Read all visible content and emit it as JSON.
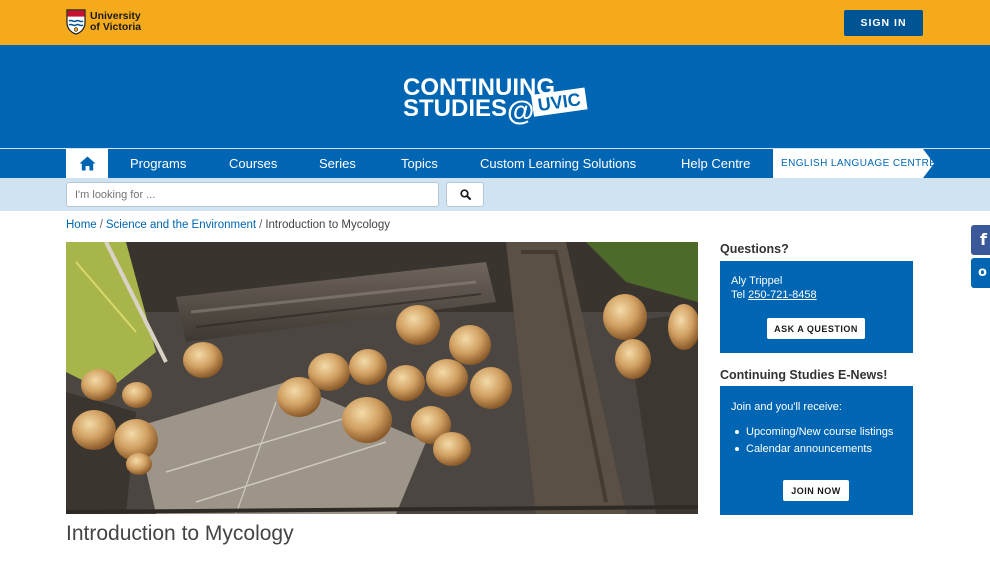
{
  "header": {
    "university_name": "University of Victoria",
    "signin_label": "SIGN IN"
  },
  "banner": {
    "logo_line1": "CONTINUING",
    "logo_line2": "STUDIES",
    "logo_at": "@",
    "logo_uvic": "UVIC"
  },
  "nav": {
    "home_icon": "home-icon",
    "items": [
      {
        "label": "Programs"
      },
      {
        "label": "Courses"
      },
      {
        "label": "Series"
      },
      {
        "label": "Topics"
      },
      {
        "label": "Custom Learning Solutions"
      },
      {
        "label": "Help Centre"
      }
    ],
    "elc_label": "ENGLISH LANGUAGE CENTRE"
  },
  "search": {
    "placeholder": "I'm looking for ...",
    "button_icon": "search-icon"
  },
  "breadcrumb": {
    "items": [
      "Home",
      "Science and the Environment",
      "Introduction to Mycology"
    ],
    "separator": "/"
  },
  "main": {
    "title": "Introduction to Mycology"
  },
  "sidebar": {
    "questions_heading": "Questions?",
    "contact_name": "Aly Trippel",
    "tel_label": "Tel",
    "tel_number": "250-721-8458",
    "ask_button": "ASK A QUESTION",
    "enews_heading": "Continuing Studies E-News!",
    "enews_intro": "Join and you'll receive:",
    "enews_items": [
      "Upcoming/New course listings",
      "Calendar announcements"
    ],
    "join_button": "JOIN NOW"
  },
  "social": {
    "facebook_glyph": "f",
    "outlook_glyph": "o"
  },
  "colors": {
    "gold": "#F5AA1C",
    "blue": "#0066B3",
    "dark_blue": "#005493",
    "light_blue": "#CFE3F2"
  }
}
